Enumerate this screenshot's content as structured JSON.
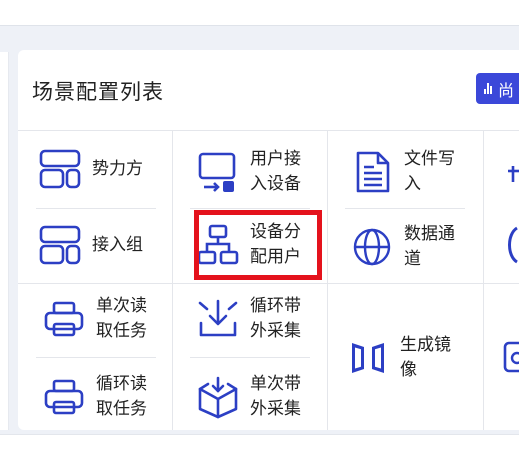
{
  "card": {
    "title": "场景配置列表",
    "button_label": "尚"
  },
  "items": {
    "shili": "势力方",
    "user_access": "用户接入设备",
    "file_write": "文件写入",
    "join_group": "接入组",
    "device_assign": "设备分配用户",
    "data_channel": "数据通道",
    "single_read": "单次读取任务",
    "cycle_collect": "循环带外采集",
    "cycle_read": "循环读取任务",
    "single_collect": "单次带外采集",
    "mirror": "生成镜像"
  },
  "colors": {
    "icon": "#2c3fc4",
    "accent": "#3b48d9",
    "highlight": "#e4121c"
  }
}
